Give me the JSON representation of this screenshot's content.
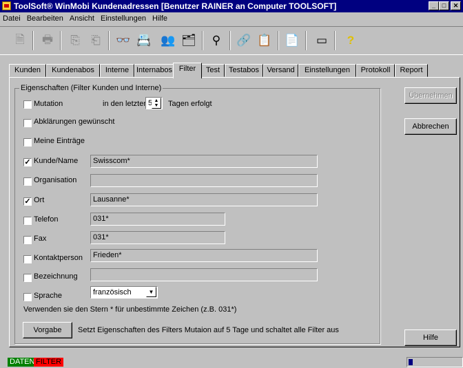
{
  "window": {
    "title": "ToolSoft® WinMobi Kundenadressen [Benutzer RAINER an Computer TOOLSOFT]",
    "controls": [
      "_",
      "□",
      "✕"
    ]
  },
  "menu": [
    {
      "label": "Datei"
    },
    {
      "label": "Bearbeiten"
    },
    {
      "label": "Ansicht"
    },
    {
      "label": "Einstellungen"
    },
    {
      "label": "Hilfe"
    }
  ],
  "toolbar": [
    {
      "name": "new-doc-icon",
      "glyph": "🗎",
      "enabled": false
    },
    {
      "name": "print-icon",
      "glyph": "🖶",
      "enabled": false
    },
    {
      "name": "copy-icon",
      "glyph": "⎘",
      "enabled": false
    },
    {
      "name": "paste-icon",
      "glyph": "⎗",
      "enabled": false
    },
    {
      "name": "search-binoculars-icon",
      "glyph": "👓",
      "enabled": true
    },
    {
      "name": "card-edit-icon",
      "glyph": "📇",
      "enabled": true
    },
    {
      "name": "search-person-icon",
      "glyph": "👥",
      "enabled": true
    },
    {
      "name": "card-add-icon",
      "glyph": "🗂",
      "enabled": true
    },
    {
      "name": "filter-icon",
      "glyph": "⚲",
      "enabled": true
    },
    {
      "name": "link-icon",
      "glyph": "🔗",
      "enabled": true
    },
    {
      "name": "card-list-icon",
      "glyph": "📋",
      "enabled": true
    },
    {
      "name": "report-icon",
      "glyph": "📄",
      "enabled": true
    },
    {
      "name": "window-icon",
      "glyph": "▭",
      "enabled": true
    },
    {
      "name": "help-icon",
      "glyph": "?",
      "enabled": true
    }
  ],
  "tabs": [
    "Kunden",
    "Kundenabos",
    "Interne",
    "Internabos",
    "Filter",
    "Test",
    "Testabos",
    "Versand",
    "Einstellungen",
    "Protokoll",
    "Report"
  ],
  "active_tab": "Filter",
  "group_label": "Eigenschaften (Filter Kunden und Interne)",
  "mutation": {
    "label": "Mutation",
    "checked": false,
    "prefix": "in den letzten",
    "days": "5",
    "suffix": "Tagen erfolgt"
  },
  "options": [
    {
      "label": "Abklärungen gewünscht",
      "checked": false
    },
    {
      "label": "Meine Einträge",
      "checked": false
    }
  ],
  "filters": [
    {
      "label": "Kunde/Name",
      "checked": true,
      "value": "Swisscom*"
    },
    {
      "label": "Organisation",
      "checked": false,
      "value": ""
    },
    {
      "label": "Ort",
      "checked": true,
      "value": "Lausanne*"
    },
    {
      "label": "Telefon",
      "checked": false,
      "value": "031*"
    },
    {
      "label": "Fax",
      "checked": false,
      "value": "031*"
    },
    {
      "label": "Kontaktperson",
      "checked": false,
      "value": "Frieden*"
    },
    {
      "label": "Bezeichnung",
      "checked": false,
      "value": ""
    }
  ],
  "sprache": {
    "label": "Sprache",
    "checked": false,
    "value": "französisch"
  },
  "hint": "Verwenden sie den Stern * für unbestimmte Zeichen (z.B. 031*)",
  "vorgabe": {
    "button": "Vorgabe",
    "text": "Setzt Eigenschaften des Filters Mutaion auf 5 Tage und schaltet alle Filter aus"
  },
  "buttons": {
    "apply": "Übernehmen",
    "cancel": "Abbrechen",
    "help": "Hilfe"
  },
  "status": {
    "daten": "DATEN",
    "filter": "FILTER",
    "daten_color": "#008000",
    "filter_color": "#ff0000"
  }
}
